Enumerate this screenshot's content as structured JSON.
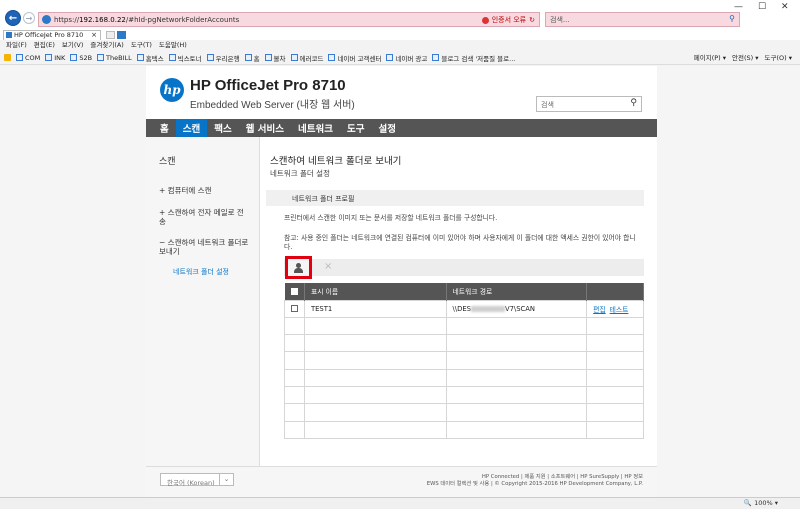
{
  "browser": {
    "url_prefix": "https://",
    "url_host": "192.168.0.22",
    "url_path": "/#hId-pgNetworkFolderAccounts",
    "cert_error": "인증서 오류",
    "search_placeholder": "검색...",
    "tab_title": "HP OfficeJet Pro 8710",
    "tab_close": "×",
    "zoom": "100%",
    "menu": [
      "파일(F)",
      "편집(E)",
      "보기(V)",
      "즐겨찾기(A)",
      "도구(T)",
      "도움말(H)"
    ],
    "favorites": [
      "COM",
      "INK",
      "S2B",
      "TheBILL",
      "홈텍스",
      "빅스토너",
      "우리은행",
      "홈",
      "볼차",
      "에러코드",
      "네이버 고객센터",
      "네이버 광고",
      "블로그 검색 '저품질 블로..."
    ],
    "commands": [
      "페이지(P) ▾",
      "안전(S) ▾",
      "도구(O) ▾"
    ]
  },
  "ews": {
    "product_name": "HP OfficeJet Pro 8710",
    "subtitle": "Embedded Web Server (내장 웹 서버)",
    "search_placeholder": "검색",
    "nav": [
      "홈",
      "스캔",
      "팩스",
      "웹 서비스",
      "네트워크",
      "도구",
      "설정"
    ],
    "active_nav": "스캔",
    "sidebar": {
      "title": "스캔",
      "items": [
        "+ 컴퓨터에 스캔",
        "+ 스캔하여 전자 메일로 전송",
        "− 스캔하여 네트워크 폴더로 보내기"
      ],
      "sub_item": "네트워크 폴더 설정"
    },
    "content": {
      "title": "스캔하여 네트워크 폴더로 보내기",
      "subtitle": "네트워크 폴더 설정",
      "section_header": "네트워크 폴더 프로필",
      "description": "프린터에서 스캔한 이미지 또는 문서를 저장할 네트워크 폴더를 구성합니다.",
      "note": "참고: 사용 중인 폴더는 네트워크에 연결된 컴퓨터에 이미 있어야 하며 사용자에게 이 폴더에 대한 액세스 권한이 있어야 합니다.",
      "delete_symbol": "×",
      "table": {
        "headers": [
          "표시 이름",
          "네트워크 경로",
          ""
        ],
        "rows": [
          {
            "name": "TEST1",
            "path_start": "\\\\DES",
            "path_end": "V7\\SCAN",
            "edit": "편집",
            "test": "테스트"
          }
        ]
      }
    },
    "footer": {
      "language": "한국어 (Korean)",
      "links": "HP Connected | 제품 지원 | 소프트웨어 | HP SureSupply | HP 정보",
      "copyright": "EWS 데이터 컬렉션 및 사용 | © Copyright 2015-2016 HP Development Company, L.P."
    }
  }
}
